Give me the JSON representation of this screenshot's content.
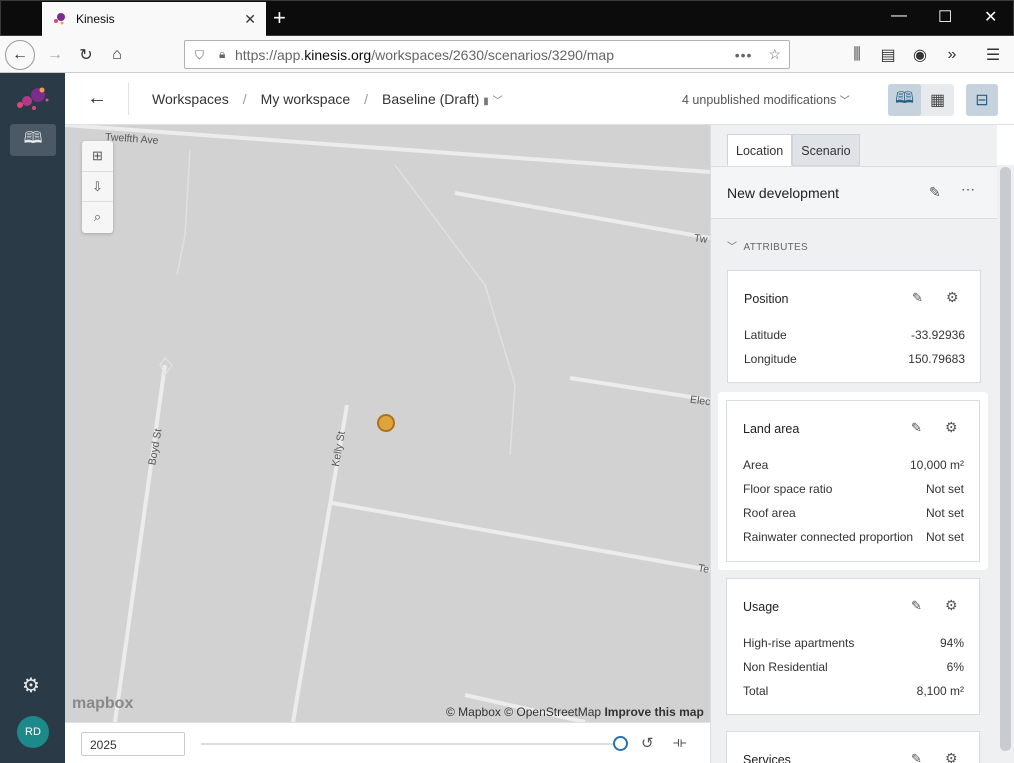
{
  "browser": {
    "tab_title": "Kinesis",
    "url_prefix": "https://app.",
    "url_host": "kinesis.org",
    "url_path": "/workspaces/2630/scenarios/3290/map"
  },
  "user": {
    "initials": "RD"
  },
  "header": {
    "crumbs": [
      "Workspaces",
      "My workspace",
      "Baseline (Draft)"
    ],
    "modifications": "4 unpublished modifications"
  },
  "map": {
    "streets": [
      "Twelfth Ave",
      "Tw",
      "Elec",
      "Boyd St",
      "Kelly St",
      "Te"
    ],
    "brand": "mapbox",
    "attribution": [
      "© Mapbox",
      "© OpenStreetMap",
      "Improve this map"
    ]
  },
  "timeline": {
    "year": "2025"
  },
  "panel": {
    "tabs": [
      "Location",
      "Scenario"
    ],
    "active_tab": "Location",
    "title": "New development",
    "section_label": "ATTRIBUTES",
    "cards": [
      {
        "title": "Position",
        "rows": [
          [
            "Latitude",
            "-33.92936"
          ],
          [
            "Longitude",
            "150.79683"
          ]
        ]
      },
      {
        "title": "Land area",
        "rows": [
          [
            "Area",
            "10,000 m²"
          ],
          [
            "Floor space ratio",
            "Not set"
          ],
          [
            "Roof area",
            "Not set"
          ],
          [
            "Rainwater connected proportion",
            "Not set"
          ]
        ]
      },
      {
        "title": "Usage",
        "rows": [
          [
            "High-rise apartments",
            "94%"
          ],
          [
            "Non Residential",
            "6%"
          ],
          [
            "Total",
            "8,100 m²"
          ]
        ]
      },
      {
        "title": "Services",
        "rows": []
      }
    ]
  },
  "colors": {
    "sidebar": "#2a3a46",
    "marker": "#e0a53a",
    "accent": "#2a6fb0"
  }
}
